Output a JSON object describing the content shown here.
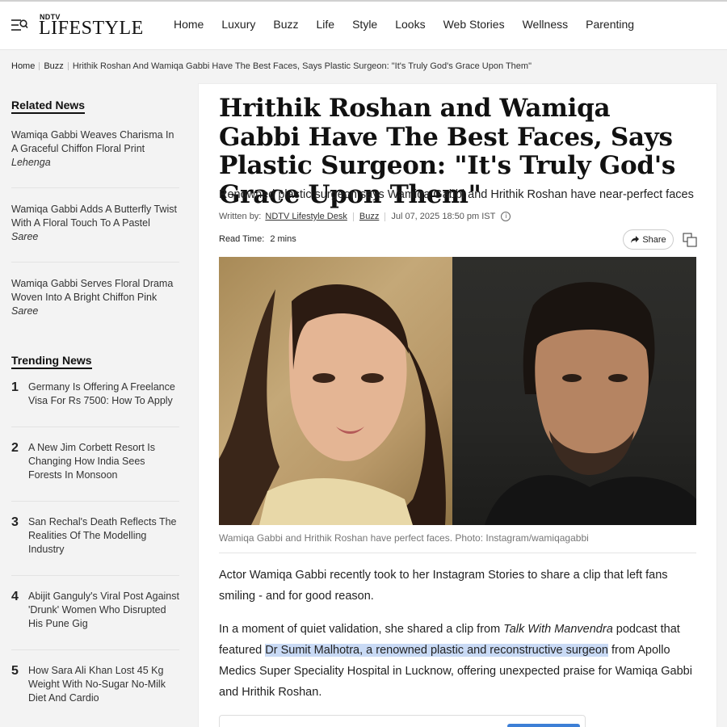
{
  "header": {
    "logo_ndtv": "NDTV",
    "logo_lifestyle": "LIFESTYLE",
    "nav": [
      "Home",
      "Luxury",
      "Buzz",
      "Life",
      "Style",
      "Looks",
      "Web Stories",
      "Wellness",
      "Parenting"
    ]
  },
  "breadcrumb": {
    "home": "Home",
    "section": "Buzz",
    "title": "Hrithik Roshan And Wamiqa Gabbi Have The Best Faces, Says Plastic Surgeon: \"It's Truly God's Grace Upon Them\""
  },
  "sidebar": {
    "related_title": "Related News",
    "related": [
      {
        "text": "Wamiqa Gabbi Weaves Charisma In A Graceful Chiffon Floral Print",
        "em": "Lehenga"
      },
      {
        "text": "Wamiqa Gabbi Adds A Butterfly Twist With A Floral Touch To A Pastel",
        "em": "Saree"
      },
      {
        "text": "Wamiqa Gabbi Serves Floral Drama Woven Into A Bright Chiffon Pink",
        "em": "Saree"
      }
    ],
    "trending_title": "Trending News",
    "trending": [
      {
        "num": "1",
        "text": "Germany Is Offering A Freelance Visa For Rs 7500: How To Apply"
      },
      {
        "num": "2",
        "text": "A New Jim Corbett Resort Is Changing How India Sees Forests In Monsoon"
      },
      {
        "num": "3",
        "text": "San Rechal's Death Reflects The Realities Of The Modelling Industry"
      },
      {
        "num": "4",
        "text": "Abijit Ganguly's Viral Post Against 'Drunk' Women Who Disrupted His Pune Gig"
      },
      {
        "num": "5",
        "text": "How Sara Ali Khan Lost 45 Kg Weight With No-Sugar No-Milk Diet And Cardio"
      }
    ]
  },
  "article": {
    "headline": "Hrithik Roshan and Wamiqa Gabbi Have The Best Faces, Says Plastic Surgeon: \"It's Truly God's Grace Upon Them\"",
    "subhead": "Renowned plastic surgeon says Wamiqa Gabbi and Hrithik Roshan have near-perfect faces",
    "written_by_label": "Written by:",
    "author": "NDTV Lifestyle Desk",
    "category": "Buzz",
    "date": "Jul 07, 2025 18:50 pm IST",
    "read_time_label": "Read Time:",
    "read_time": "2 mins",
    "share_label": "Share",
    "caption": "Wamiqa Gabbi and Hrithik Roshan have perfect faces. Photo: Instagram/wamiqagabbi",
    "para1": "Actor Wamiqa Gabbi recently took to her Instagram Stories to share a clip that left fans smiling - and for good reason.",
    "para2_a": "In a moment of quiet validation, she shared a clip from ",
    "para2_show": "Talk With Manvendra",
    "para2_b": " podcast that featured ",
    "para2_highlight": "Dr Sumit Malhotra, a renowned plastic and reconstructive surgeon",
    "para2_c": " from Apollo Medics Super Speciality Hospital in Lucknow, offering unexpected praise for Wamiqa Gabbi and Hrithik Roshan."
  }
}
